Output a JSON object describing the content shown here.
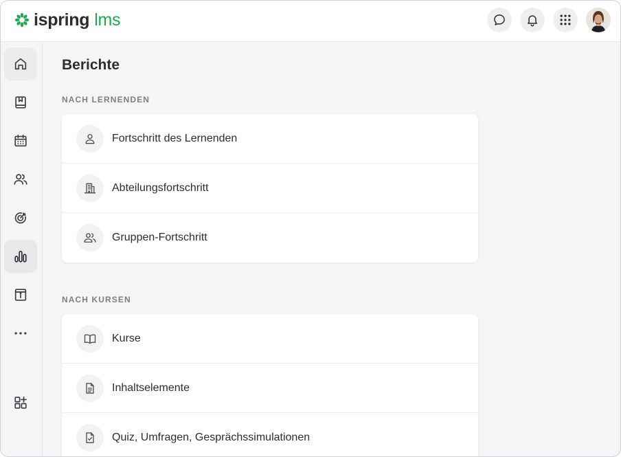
{
  "brand": {
    "name_part1": "ispring",
    "name_part2": "lms",
    "accent": "#22a653"
  },
  "header": {
    "actions": [
      {
        "name": "chat-icon"
      },
      {
        "name": "bell-icon"
      },
      {
        "name": "apps-grid-icon"
      }
    ],
    "avatar": "user-avatar"
  },
  "sidebar": {
    "items": [
      {
        "icon": "home-icon"
      },
      {
        "icon": "bookmark-book-icon"
      },
      {
        "icon": "calendar-icon"
      },
      {
        "icon": "users-icon"
      },
      {
        "icon": "target-icon"
      },
      {
        "icon": "bar-chart-icon",
        "active": true
      },
      {
        "icon": "info-archive-icon"
      },
      {
        "icon": "more-icon"
      },
      {
        "icon": "add-widget-icon"
      }
    ]
  },
  "main": {
    "title": "Berichte",
    "sections": [
      {
        "title": "NACH LERNENDEN",
        "items": [
          {
            "label": "Fortschritt des Lernenden",
            "icon": "person-icon"
          },
          {
            "label": "Abteilungsfortschritt",
            "icon": "building-icon"
          },
          {
            "label": "Gruppen-Fortschritt",
            "icon": "group-icon"
          }
        ]
      },
      {
        "title": "NACH KURSEN",
        "items": [
          {
            "label": "Kurse",
            "icon": "open-book-icon"
          },
          {
            "label": "Inhaltselemente",
            "icon": "document-icon"
          },
          {
            "label": "Quiz, Umfragen, Gesprächssimulationen",
            "icon": "checklist-icon"
          }
        ]
      }
    ]
  }
}
